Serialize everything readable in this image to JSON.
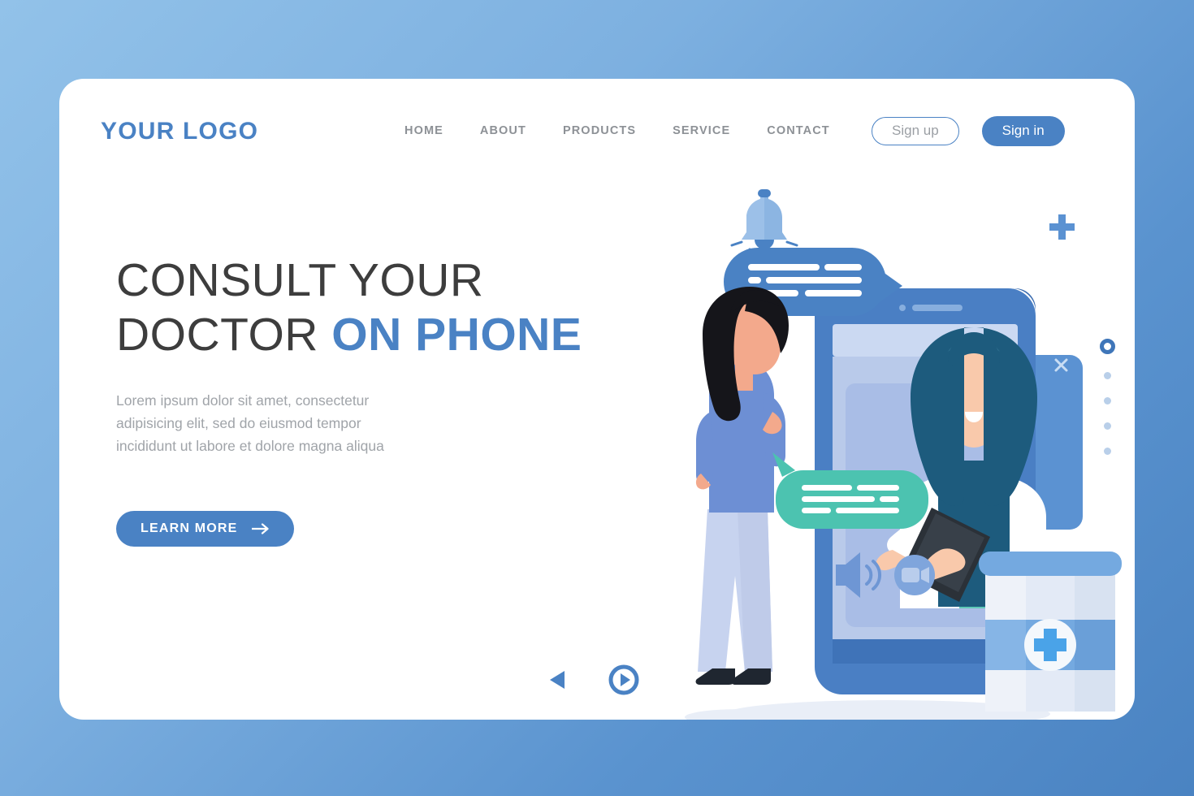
{
  "brand": {
    "logo": "YOUR LOGO",
    "accent_color": "#4a82c4"
  },
  "nav": {
    "items": [
      {
        "label": "HOME"
      },
      {
        "label": "ABOUT"
      },
      {
        "label": "PRODUCTS"
      },
      {
        "label": "SERVICE"
      },
      {
        "label": "CONTACT"
      }
    ]
  },
  "auth": {
    "sign_up_label": "Sign up",
    "sign_in_label": "Sign in"
  },
  "hero": {
    "headline_part1": "CONSULT YOUR DOCTOR ",
    "headline_accent": "ON PHONE",
    "paragraph": "Lorem ipsum dolor sit amet, consectetur adipisicing elit, sed do eiusmod tempor incididunt ut labore et dolore magna aliqua",
    "cta_label": "LEARN MORE",
    "cta_icon": "arrow-right-icon"
  },
  "illustration": {
    "bell_icon": "notification-bell-icon",
    "plus_icon": "plus-icon",
    "circle_icon": "circle-outline-icon",
    "close_icon": "close-x-icon",
    "speaker_icon": "speaker-volume-icon",
    "video_icon": "video-camera-icon",
    "medicine_cross_icon": "medical-cross-icon",
    "doctor_label": "doctor-avatar",
    "patient_label": "patient-avatar",
    "chat_bubble_blue": "incoming-message-bubble",
    "chat_bubble_teal": "outgoing-message-bubble",
    "colors": {
      "phone_frame": "#4a7fc4",
      "phone_screen": "#b9caea",
      "bubble_blue": "#4a82c4",
      "bubble_teal": "#4cc3b0",
      "hijab": "#1d5b7d",
      "skin": "#f9c9ab",
      "coat": "#ffffff",
      "patient_top": "#6d8fd4",
      "patient_pants": "#c7d3ef",
      "hair": "#1a1a1a",
      "bottle_label": "#74a9e0"
    }
  },
  "carousel": {
    "prev_icon": "triangle-left-icon",
    "next_icon": "play-circle-icon",
    "dots": [
      {
        "active": true
      },
      {
        "active": false
      },
      {
        "active": false
      },
      {
        "active": false
      },
      {
        "active": false
      }
    ]
  }
}
